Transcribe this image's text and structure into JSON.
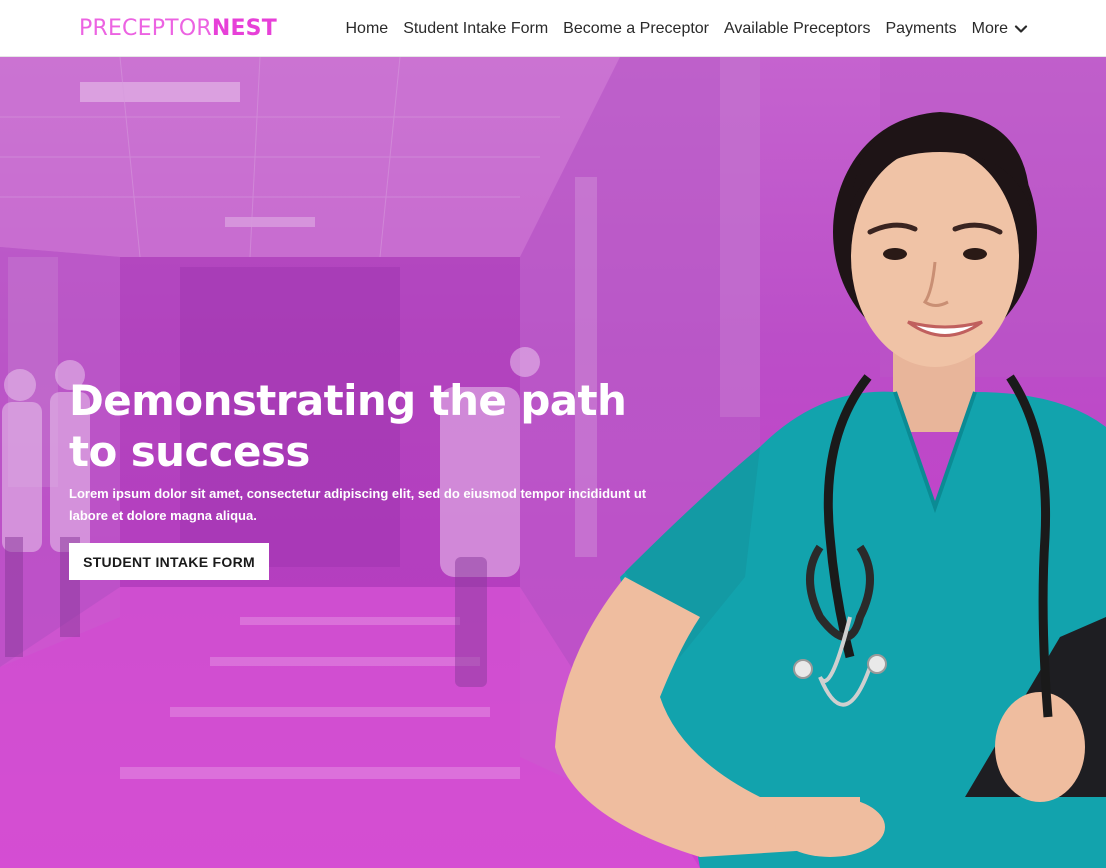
{
  "brand": {
    "logo_light": "PRECEPTOR",
    "logo_bold": "NEST",
    "color_light": "#ec63e2",
    "color_bold": "#e740d8"
  },
  "nav": {
    "items": [
      {
        "label": "Home"
      },
      {
        "label": "Student Intake Form"
      },
      {
        "label": "Become a Preceptor"
      },
      {
        "label": "Available Preceptors"
      },
      {
        "label": "Payments"
      }
    ],
    "more_label": "More",
    "more_icon": "chevron-down-icon"
  },
  "hero": {
    "title": "Demonstrating the path to success",
    "subtitle": "Lorem ipsum dolor sit amet, consectetur adipiscing elit, sed do eiusmod tempor incididunt ut labore et dolore magna aliqua.",
    "cta_label": "STUDENT INTAKE FORM",
    "overlay_color": "#c14ac9",
    "image_description_icon": "nurse-photo"
  }
}
